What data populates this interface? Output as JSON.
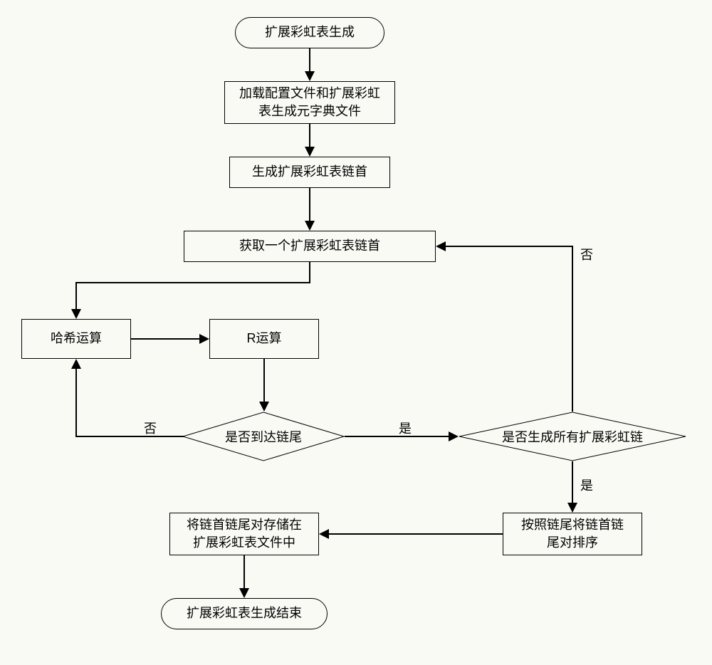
{
  "nodes": {
    "start": "扩展彩虹表生成",
    "load_config": "加载配置文件和扩展彩虹\n表生成元字典文件",
    "gen_head": "生成扩展彩虹表链首",
    "get_head": "获取一个扩展彩虹表链首",
    "hash_op": "哈希运算",
    "r_op": "R运算",
    "reach_tail": "是否到达链尾",
    "all_chains": "是否生成所有扩展彩虹链",
    "sort_pairs": "按照链尾将链首链\n尾对排序",
    "store_pairs": "将链首链尾对存储在\n扩展彩虹表文件中",
    "end": "扩展彩虹表生成结束"
  },
  "labels": {
    "no": "否",
    "yes": "是"
  }
}
